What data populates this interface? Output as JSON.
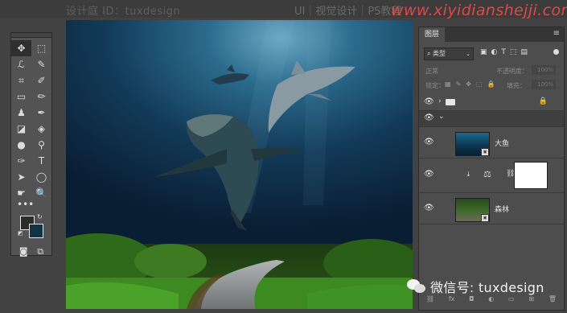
{
  "top_bar": {
    "designer_label": "设计庭 ID：tuxdesign",
    "site_label": "UI｜视觉设计｜PS教程"
  },
  "watermark": "www.xiyidianshejji.com",
  "tools": [
    {
      "icon": "move-icon",
      "glyph": "✥"
    },
    {
      "icon": "marquee-icon",
      "glyph": "⬚"
    },
    {
      "icon": "lasso-icon",
      "glyph": "ℒ"
    },
    {
      "icon": "quick-select-icon",
      "glyph": "✎"
    },
    {
      "icon": "crop-icon",
      "glyph": "⌗"
    },
    {
      "icon": "eyedropper-icon",
      "glyph": "✐"
    },
    {
      "icon": "frame-icon",
      "glyph": "▭"
    },
    {
      "icon": "brush-icon",
      "glyph": "✏"
    },
    {
      "icon": "stamp-icon",
      "glyph": "♟"
    },
    {
      "icon": "history-brush-icon",
      "glyph": "✒"
    },
    {
      "icon": "eraser-icon",
      "glyph": "◪"
    },
    {
      "icon": "bucket-icon",
      "glyph": "◈"
    },
    {
      "icon": "blur-icon",
      "glyph": "●"
    },
    {
      "icon": "dodge-icon",
      "glyph": "⚲"
    },
    {
      "icon": "pen-icon",
      "glyph": "✑"
    },
    {
      "icon": "type-icon",
      "glyph": "T"
    },
    {
      "icon": "path-select-icon",
      "glyph": "➤"
    },
    {
      "icon": "ellipse-icon",
      "glyph": "◯"
    },
    {
      "icon": "hand-icon",
      "glyph": "☛"
    },
    {
      "icon": "zoom-icon",
      "glyph": "🔍"
    }
  ],
  "tools_more": "•••",
  "colors": {
    "foreground": "#2c2c2c",
    "background": "#123344"
  },
  "layers_panel": {
    "tab_label": "图层",
    "menu_icon": "≡",
    "filter_kind": "类型",
    "blend_mode": "正常",
    "opacity_label": "不透明度：",
    "opacity_value": "100%",
    "lock_label": "锁定：",
    "fill_label": "填充：",
    "fill_value": "100%",
    "layers": [
      {
        "type": "group",
        "name": ""
      },
      {
        "type": "group-open",
        "name": ""
      },
      {
        "type": "image",
        "name": "大鱼",
        "thumb": "fish"
      },
      {
        "type": "adjustment",
        "name": ""
      },
      {
        "type": "image",
        "name": "森林",
        "thumb": "forest"
      }
    ],
    "bottom_icons": [
      "link-icon",
      "fx-icon",
      "mask-icon",
      "adjustment-icon",
      "folder-icon",
      "new-layer-icon",
      "trash-icon"
    ]
  },
  "wechat": {
    "label": "微信号: tuxdesign"
  }
}
